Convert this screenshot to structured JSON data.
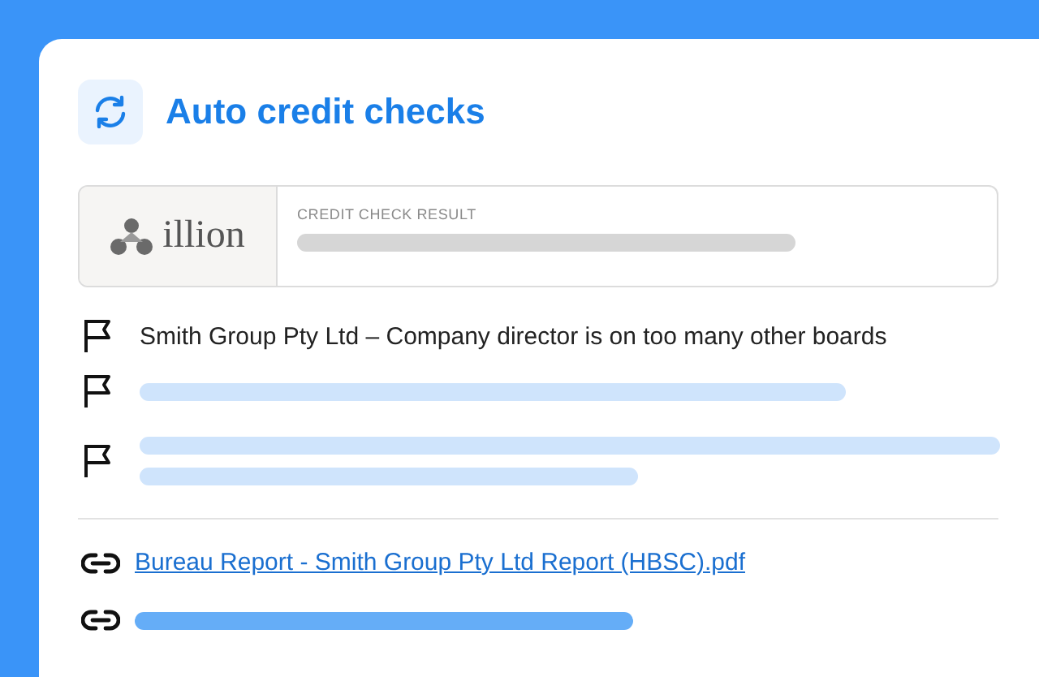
{
  "header": {
    "title": "Auto credit checks"
  },
  "bureau": {
    "logo_text": "illion",
    "result_label": "CREDIT CHECK RESULT"
  },
  "flags": [
    {
      "kind": "text",
      "text": "Smith Group Pty Ltd – Company director is on too many other boards"
    },
    {
      "kind": "placeholder"
    },
    {
      "kind": "placeholder_two_lines"
    }
  ],
  "links": [
    {
      "kind": "link",
      "text": "Bureau Report - Smith Group Pty Ltd Report (HBSC).pdf"
    },
    {
      "kind": "placeholder"
    }
  ]
}
